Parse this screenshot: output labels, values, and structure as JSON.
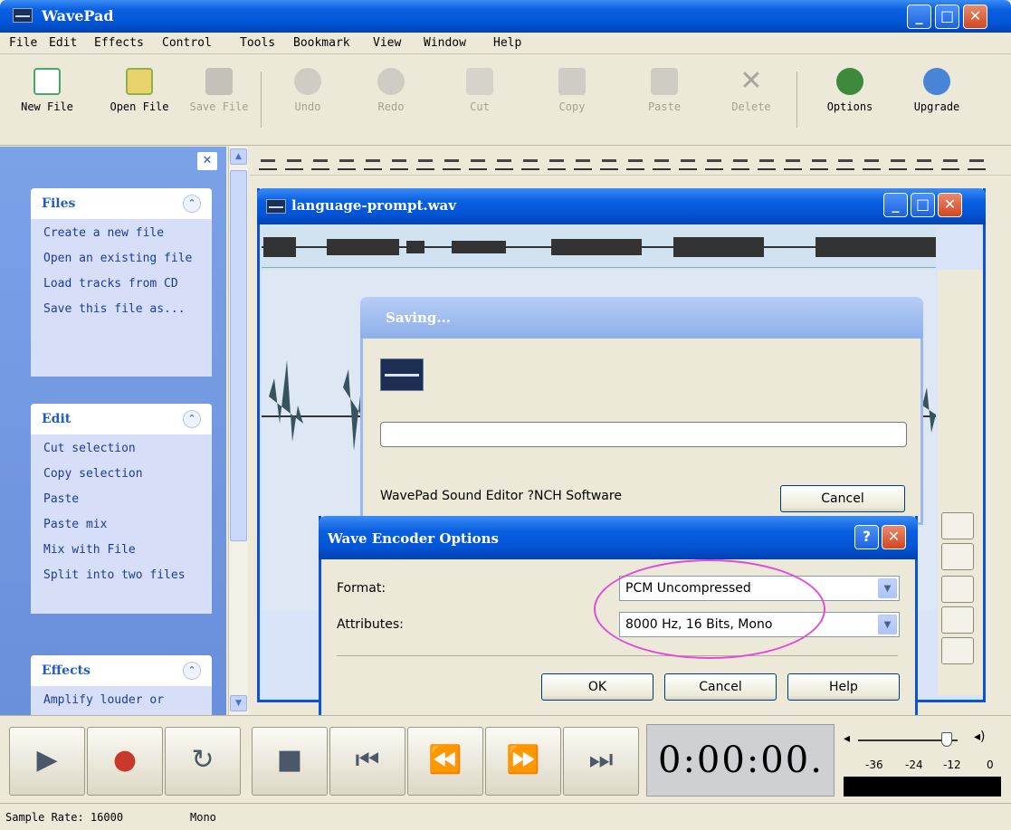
{
  "app": {
    "title": "WavePad"
  },
  "menu": [
    "File",
    "Edit",
    "Effects",
    "Control",
    "Tools",
    "Bookmark",
    "View",
    "Window",
    "Help"
  ],
  "toolbar": {
    "new_file": "New File",
    "open_file": "Open File",
    "save_file": "Save File",
    "undo": "Undo",
    "redo": "Redo",
    "cut": "Cut",
    "copy": "Copy",
    "paste": "Paste",
    "delete": "Delete",
    "options": "Options",
    "upgrade": "Upgrade"
  },
  "taskpane": {
    "files": {
      "title": "Files",
      "links": [
        "Create a new file",
        "Open an existing file",
        "Load tracks from CD",
        "Save this file as..."
      ]
    },
    "edit": {
      "title": "Edit",
      "links": [
        "Cut selection",
        "Copy selection",
        "Paste",
        "Paste mix",
        "Mix with File",
        "Split into two files"
      ]
    },
    "effects": {
      "title": "Effects",
      "links": [
        "Amplify louder or"
      ]
    }
  },
  "document": {
    "title": "language-prompt.wav"
  },
  "saving": {
    "title": "Saving...",
    "message": "WavePad Sound Editor ?NCH Software",
    "cancel": "Cancel"
  },
  "encoder": {
    "title": "Wave Encoder Options",
    "format_label": "Format:",
    "format_value": "PCM Uncompressed",
    "attributes_label": "Attributes:",
    "attributes_value": "8000 Hz, 16 Bits, Mono",
    "ok": "OK",
    "cancel": "Cancel",
    "help": "Help",
    "help_title": "?"
  },
  "transport": {
    "time": "0:00:00.",
    "meter_ticks": [
      "-36",
      "-24",
      "-12",
      "0"
    ]
  },
  "status": {
    "sample_rate": "Sample Rate: 16000",
    "channels": "Mono"
  },
  "colors": {
    "titlebar": "#0a5fe0",
    "taskpane": "#7ba2e7",
    "waveform": "#37545e",
    "highlight": "#e24ad7",
    "record": "#c8392b"
  }
}
